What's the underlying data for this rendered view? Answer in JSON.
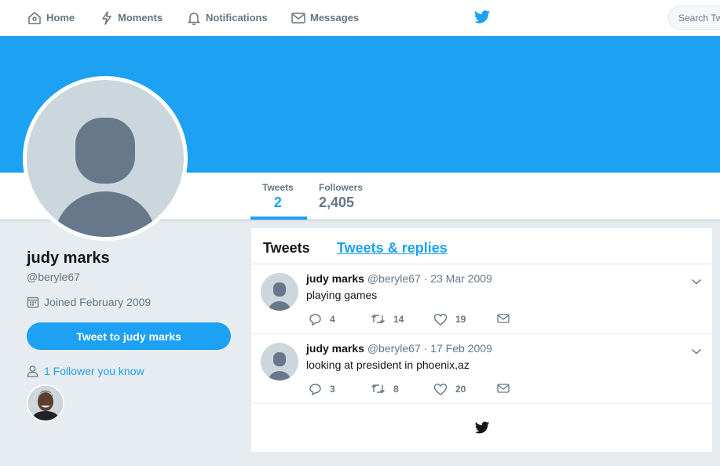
{
  "nav": {
    "home": "Home",
    "moments": "Moments",
    "notifications": "Notifications",
    "messages": "Messages",
    "search_placeholder": "Search Twitter"
  },
  "stats": [
    {
      "label": "Tweets",
      "value": "2"
    },
    {
      "label": "Followers",
      "value": "2,405"
    }
  ],
  "profile": {
    "name": "judy marks",
    "handle": "@beryle67",
    "joined": "Joined February 2009",
    "tweet_to_label": "Tweet to judy marks",
    "followers_you_know": "1 Follower you know"
  },
  "timeline": {
    "tabs": [
      "Tweets",
      "Tweets & replies"
    ],
    "tweets": [
      {
        "name": "judy marks",
        "handle": "@beryle67",
        "separator": "·",
        "date": "23 Mar 2009",
        "text": "playing games",
        "replies": "4",
        "retweets": "14",
        "likes": "19"
      },
      {
        "name": "judy marks",
        "handle": "@beryle67",
        "separator": "·",
        "date": "17 Feb 2009",
        "text": "looking at president in phoenix,az",
        "replies": "3",
        "retweets": "8",
        "likes": "20"
      }
    ]
  },
  "colors": {
    "accent": "#1da1f2",
    "background": "#e6ecf0",
    "muted": "#657786"
  },
  "icons": [
    "home-icon",
    "moments-icon",
    "notifications-icon",
    "messages-icon",
    "twitter-bird-icon",
    "calendar-icon",
    "person-icon",
    "reply-icon",
    "retweet-icon",
    "like-icon",
    "direct-message-icon",
    "chevron-down-icon"
  ]
}
